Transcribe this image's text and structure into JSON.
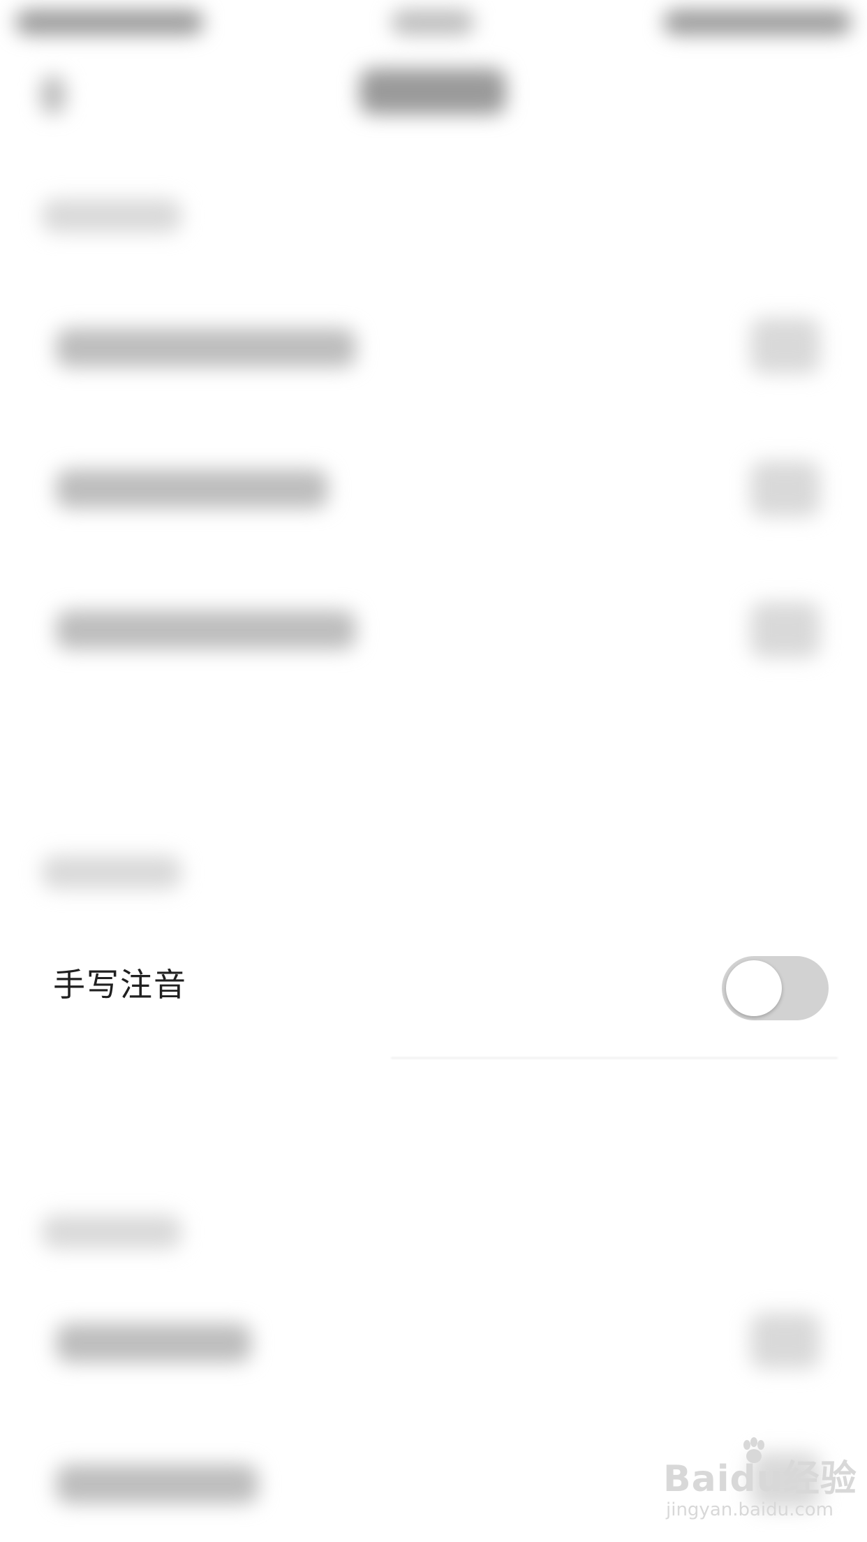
{
  "toggle_row": {
    "label": "手写注音",
    "enabled": false
  },
  "watermark": {
    "brand": "Baidu经验",
    "url": "jingyan.baidu.com"
  },
  "colors": {
    "toggle_off_track": "#d2d2d2",
    "toggle_knob": "#ffffff",
    "background": "#ffffff",
    "label_text": "#202020"
  }
}
